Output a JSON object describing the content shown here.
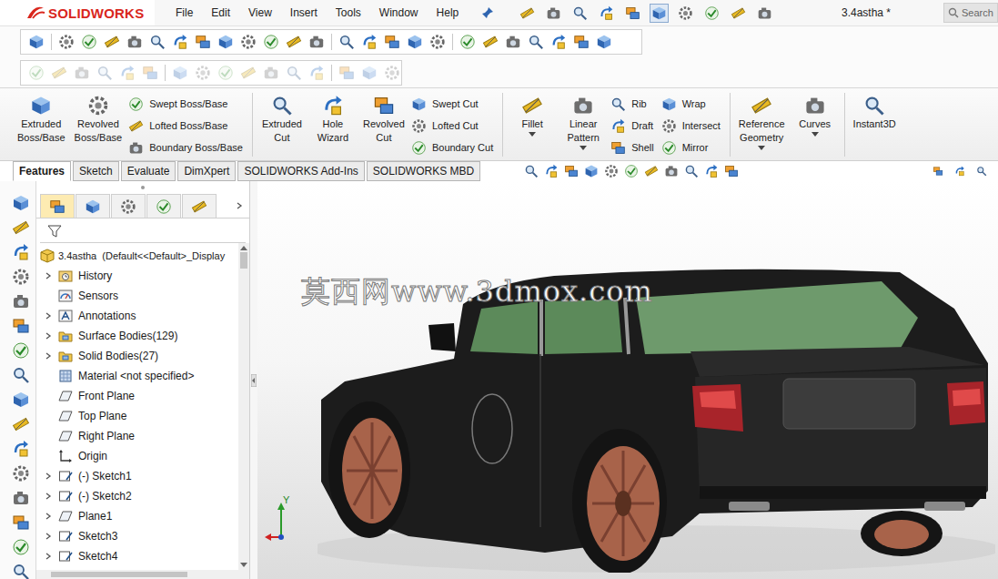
{
  "app": {
    "logo": "SOLIDWORKS",
    "document_title": "3.4astha *"
  },
  "menu": [
    {
      "label": "File"
    },
    {
      "label": "Edit"
    },
    {
      "label": "View"
    },
    {
      "label": "Insert"
    },
    {
      "label": "Tools"
    },
    {
      "label": "Window"
    },
    {
      "label": "Help"
    }
  ],
  "search": {
    "placeholder": "Search"
  },
  "command_manager": {
    "groups": [
      {
        "columns": [
          {
            "kind": "large",
            "lines": [
              "Extruded",
              "Boss/Base"
            ],
            "dropdown": false
          },
          {
            "kind": "large",
            "lines": [
              "Revolved",
              "Boss/Base"
            ],
            "dropdown": false
          },
          {
            "kind": "stack",
            "items": [
              "Swept Boss/Base",
              "Lofted Boss/Base",
              "Boundary Boss/Base"
            ]
          }
        ]
      },
      {
        "columns": [
          {
            "kind": "large",
            "lines": [
              "Extruded",
              "Cut"
            ],
            "dropdown": false
          },
          {
            "kind": "large",
            "lines": [
              "Hole",
              "Wizard"
            ],
            "dropdown": false
          },
          {
            "kind": "large",
            "lines": [
              "Revolved",
              "Cut"
            ],
            "dropdown": false
          },
          {
            "kind": "stack",
            "items": [
              "Swept Cut",
              "Lofted Cut",
              "Boundary Cut"
            ]
          }
        ]
      },
      {
        "columns": [
          {
            "kind": "large",
            "lines": [
              "Fillet"
            ],
            "dropdown": true
          },
          {
            "kind": "large",
            "lines": [
              "Linear",
              "Pattern"
            ],
            "dropdown": true
          },
          {
            "kind": "stack",
            "items": [
              "Rib",
              "Draft",
              "Shell"
            ]
          },
          {
            "kind": "stack",
            "items": [
              "Wrap",
              "Intersect",
              "Mirror"
            ]
          }
        ]
      },
      {
        "columns": [
          {
            "kind": "large",
            "lines": [
              "Reference",
              "Geometry"
            ],
            "dropdown": true
          },
          {
            "kind": "large",
            "lines": [
              "Curves"
            ],
            "dropdown": true
          }
        ]
      },
      {
        "columns": [
          {
            "kind": "large",
            "lines": [
              "Instant3D"
            ],
            "dropdown": false
          }
        ]
      }
    ]
  },
  "tabs": [
    {
      "label": "Features",
      "selected": true
    },
    {
      "label": "Sketch",
      "selected": false
    },
    {
      "label": "Evaluate",
      "selected": false
    },
    {
      "label": "DimXpert",
      "selected": false
    },
    {
      "label": "SOLIDWORKS Add-Ins",
      "selected": false
    },
    {
      "label": "SOLIDWORKS MBD",
      "selected": false
    }
  ],
  "feature_manager": {
    "panel_tabs": [
      {
        "selected": true
      },
      {
        "selected": false
      },
      {
        "selected": false
      },
      {
        "selected": false
      },
      {
        "selected": false
      }
    ],
    "root": "3.4astha  (Default<<Default>_Display",
    "items": [
      {
        "label": "History",
        "kind": "history",
        "expandable": true
      },
      {
        "label": "Sensors",
        "kind": "sensor",
        "expandable": false
      },
      {
        "label": "Annotations",
        "kind": "annotation",
        "expandable": true
      },
      {
        "label": "Surface Bodies(129)",
        "kind": "folder",
        "expandable": true
      },
      {
        "label": "Solid Bodies(27)",
        "kind": "folder",
        "expandable": true
      },
      {
        "label": "Material <not specified>",
        "kind": "material",
        "expandable": false
      },
      {
        "label": "Front Plane",
        "kind": "plane",
        "expandable": false
      },
      {
        "label": "Top Plane",
        "kind": "plane",
        "expandable": false
      },
      {
        "label": "Right Plane",
        "kind": "plane",
        "expandable": false
      },
      {
        "label": "Origin",
        "kind": "origin",
        "expandable": false
      },
      {
        "label": "(-) Sketch1",
        "kind": "sketch",
        "expandable": true
      },
      {
        "label": "(-) Sketch2",
        "kind": "sketch",
        "expandable": true
      },
      {
        "label": "Plane1",
        "kind": "plane",
        "expandable": true
      },
      {
        "label": "Sketch3",
        "kind": "sketch",
        "expandable": true
      },
      {
        "label": "Sketch4",
        "kind": "sketch",
        "expandable": true
      }
    ]
  },
  "viewport": {
    "watermark": "莫西网www.3dmox.com",
    "triad": {
      "y_label": "Y"
    }
  }
}
